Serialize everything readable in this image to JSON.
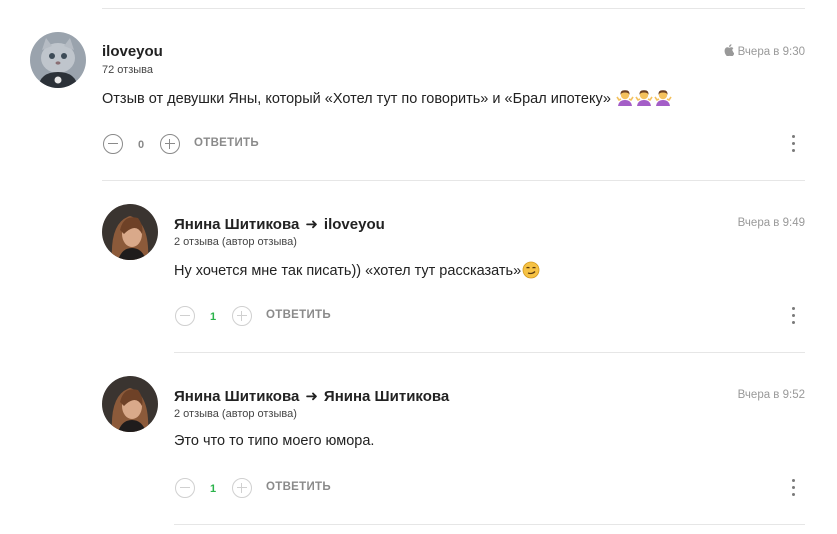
{
  "comments": [
    {
      "author": "iloveyou",
      "reply_to": "",
      "reviews": "72 отзыва",
      "time": "Вчера в 9:30",
      "device_icon": "apple-icon",
      "text": "Отзыв от девушки Яны, который «Хотел тут по говорить» и «Брал ипотеку»",
      "emoji": [
        "shrug-woman-emoji",
        "shrug-woman-emoji",
        "shrug-woman-emoji"
      ],
      "score": "0",
      "reply_label": "ОТВЕТИТЬ"
    },
    {
      "author": "Янина Шитикова",
      "reply_to": "iloveyou",
      "reviews": "2 отзыва (автор отзыва)",
      "time": "Вчера в 9:49",
      "text": "Ну хочется мне так писать)) «хотел тут рассказать»",
      "emoji": [
        "smirk-emoji"
      ],
      "score": "1",
      "reply_label": "ОТВЕТИТЬ"
    },
    {
      "author": "Янина Шитикова",
      "reply_to": "Янина Шитикова",
      "reviews": "2 отзыва (автор отзыва)",
      "time": "Вчера в 9:52",
      "text": "Это что то типо моего юмора.",
      "emoji": [],
      "score": "1",
      "reply_label": "ОТВЕТИТЬ"
    }
  ],
  "colors": {
    "score_neutral": "#888888",
    "score_positive": "#2bb34b",
    "divider": "#e6e6e6",
    "time": "#999999"
  }
}
